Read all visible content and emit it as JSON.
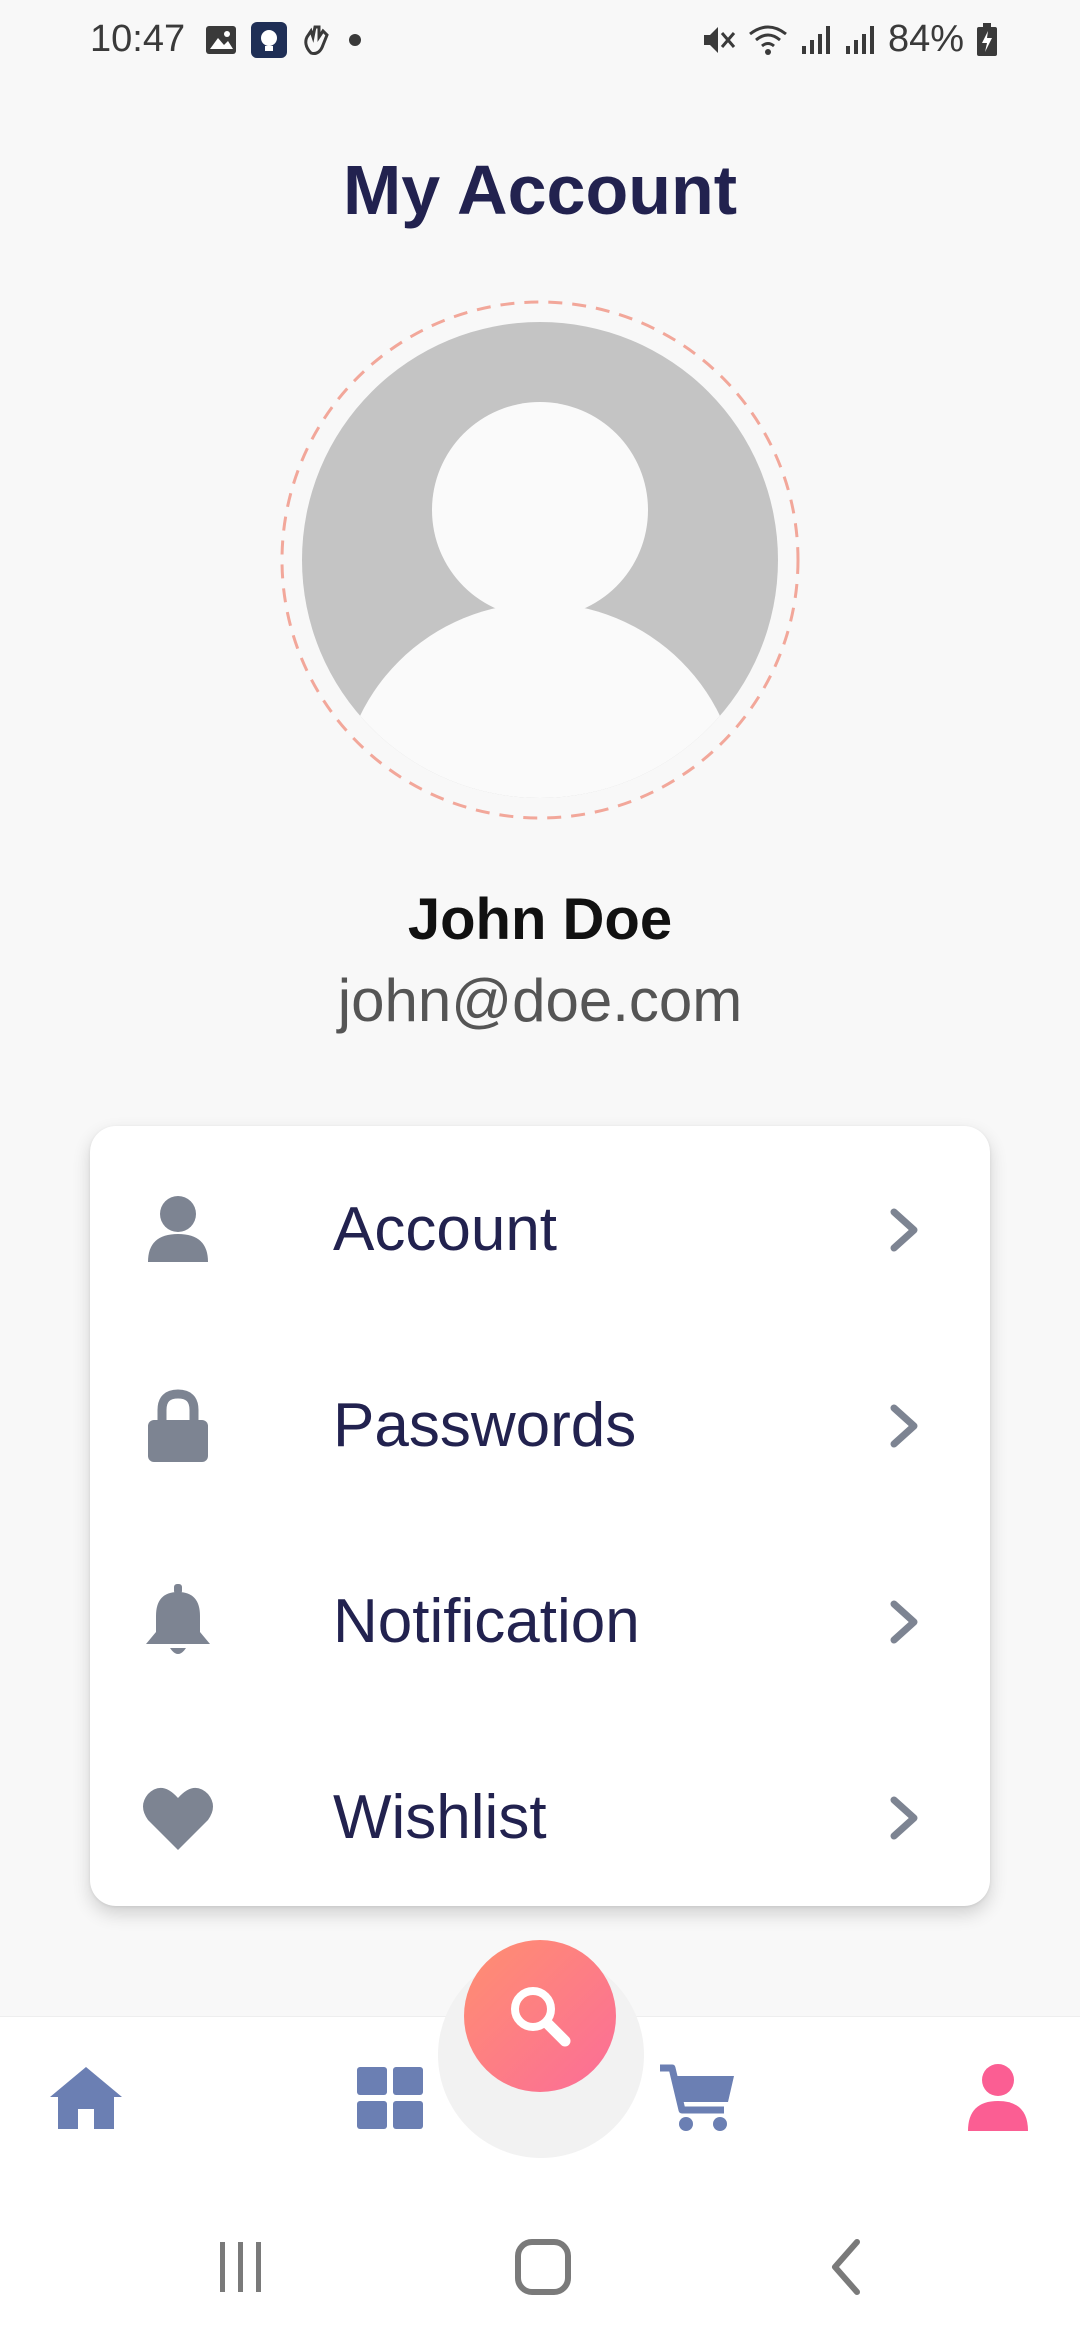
{
  "status_bar": {
    "time": "10:47",
    "battery_percent": "84%",
    "icons": [
      "image-icon",
      "app-notification-icon",
      "gesture-icon",
      "dot-icon",
      "mute-icon",
      "wifi-icon",
      "signal-icon",
      "signal-icon",
      "battery-charging-icon"
    ]
  },
  "page": {
    "title": "My Account"
  },
  "profile": {
    "name": "John Doe",
    "email": "john@doe.com",
    "avatar_icon": "default-user-avatar"
  },
  "menu": {
    "items": [
      {
        "label": "Account",
        "icon": "user-icon"
      },
      {
        "label": "Passwords",
        "icon": "lock-icon"
      },
      {
        "label": "Notification",
        "icon": "bell-icon"
      },
      {
        "label": "Wishlist",
        "icon": "heart-icon"
      }
    ]
  },
  "bottom_nav": {
    "items": [
      {
        "icon": "home-icon",
        "active": false
      },
      {
        "icon": "grid-icon",
        "active": false
      },
      {
        "icon": "search-icon",
        "active": false
      },
      {
        "icon": "cart-icon",
        "active": false
      },
      {
        "icon": "user-icon",
        "active": true
      }
    ]
  },
  "colors": {
    "title": "#22224f",
    "menu_icon": "#7d8492",
    "nav_icon": "#6b7fb3",
    "active_nav": "#fb5e93",
    "fab_gradient_start": "#ff8f70",
    "fab_gradient_end": "#fb6d98",
    "avatar_ring": "#f2a79a"
  },
  "system_nav": {
    "buttons": [
      "recent-apps-icon",
      "home-button-icon",
      "back-icon"
    ]
  }
}
